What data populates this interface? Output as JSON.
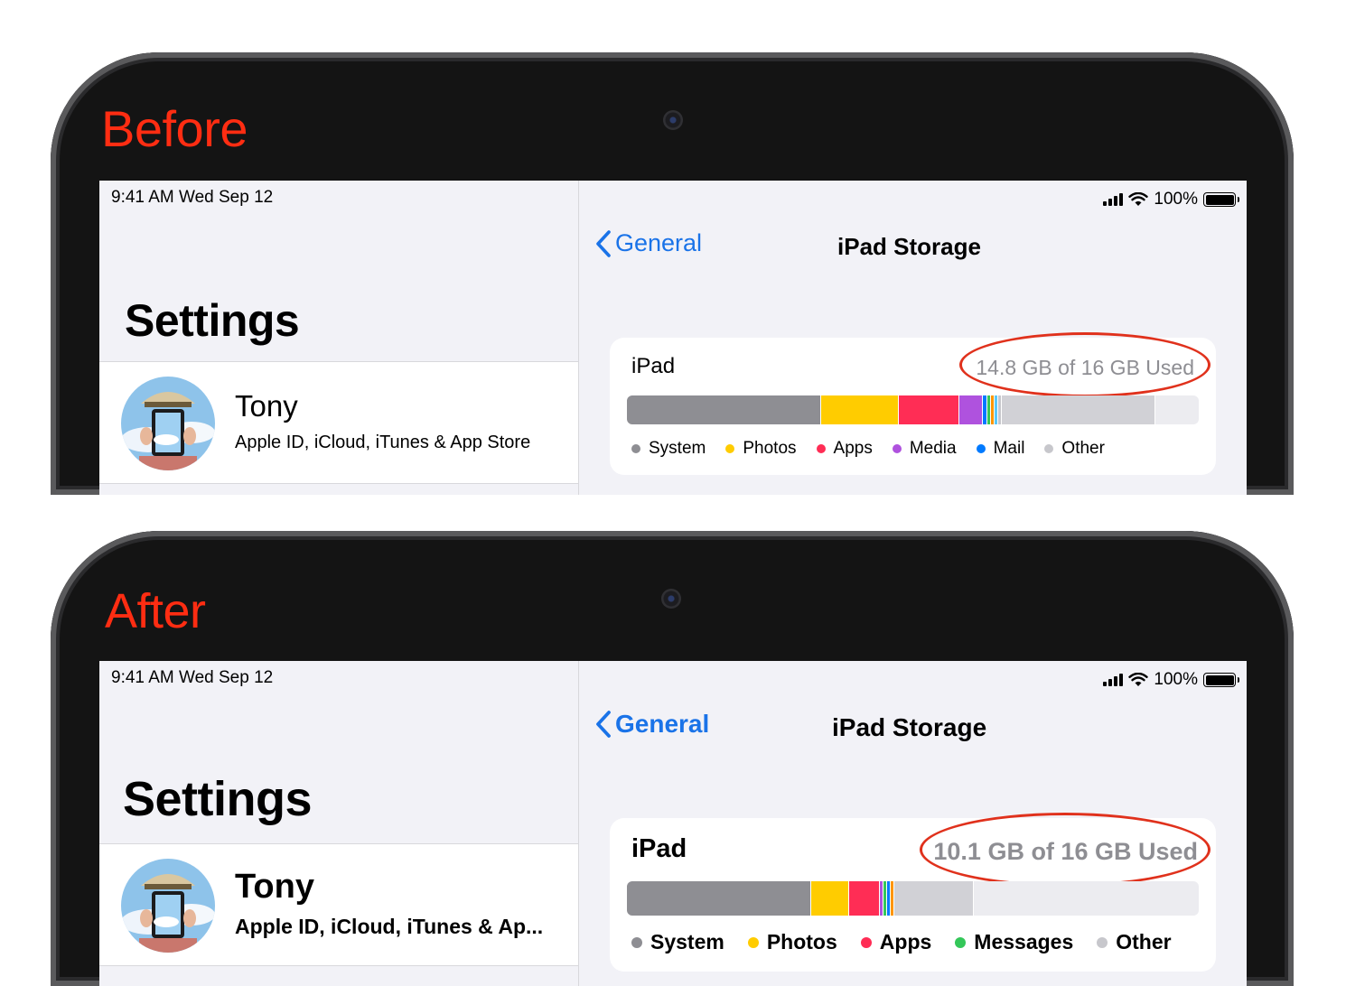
{
  "panels": [
    {
      "label": "Before",
      "status": {
        "time": "9:41 AM   Wed Sep 12",
        "battery": "100%"
      },
      "settings_title": "Settings",
      "profile": {
        "name": "Tony",
        "subtitle": "Apple ID, iCloud, iTunes & App Store"
      },
      "nav": {
        "back_label": "General",
        "title": "iPad Storage"
      },
      "storage": {
        "device": "iPad",
        "used_text": "14.8 GB of 16 GB Used",
        "used_fraction": 0.925,
        "segments": [
          {
            "name": "System",
            "share": 0.339,
            "color": "#8e8e93"
          },
          {
            "name": "Photos",
            "share": 0.137,
            "color": "#ffcc00"
          },
          {
            "name": "Apps",
            "share": 0.106,
            "color": "#ff2d55"
          },
          {
            "name": "Media",
            "share": 0.041,
            "color": "#af52de"
          },
          {
            "name": "Mail",
            "share": 0.008,
            "color": "#007aff"
          },
          {
            "name": "misc1",
            "share": 0.006,
            "color": "#34c759"
          },
          {
            "name": "misc2",
            "share": 0.006,
            "color": "#ff9500"
          },
          {
            "name": "misc3",
            "share": 0.006,
            "color": "#5ac8fa"
          },
          {
            "name": "misc4",
            "share": 0.006,
            "color": "#c7c7cc"
          },
          {
            "name": "Other",
            "share": 0.27,
            "color": "#d1d1d6"
          }
        ],
        "legend": [
          {
            "label": "System",
            "color": "#8e8e93"
          },
          {
            "label": "Photos",
            "color": "#ffcc00"
          },
          {
            "label": "Apps",
            "color": "#ff2d55"
          },
          {
            "name": "Media",
            "label": "Media",
            "color": "#af52de"
          },
          {
            "label": "Mail",
            "color": "#007aff"
          },
          {
            "label": "Other",
            "color": "#c7c7cc"
          }
        ]
      }
    },
    {
      "label": "After",
      "status": {
        "time": "9:41 AM   Wed Sep 12",
        "battery": "100%"
      },
      "settings_title": "Settings",
      "profile": {
        "name": "Tony",
        "subtitle": "Apple ID, iCloud, iTunes & Ap..."
      },
      "nav": {
        "back_label": "General",
        "title": "iPad Storage"
      },
      "storage": {
        "device": "iPad",
        "used_text": "10.1 GB of 16 GB Used",
        "used_fraction": 0.631,
        "segments": [
          {
            "name": "System",
            "share": 0.323,
            "color": "#8e8e93"
          },
          {
            "name": "Photos",
            "share": 0.065,
            "color": "#ffcc00"
          },
          {
            "name": "Apps",
            "share": 0.055,
            "color": "#ff2d55"
          },
          {
            "name": "misc1",
            "share": 0.006,
            "color": "#af52de"
          },
          {
            "name": "misc2",
            "share": 0.006,
            "color": "#34c759"
          },
          {
            "name": "misc3",
            "share": 0.006,
            "color": "#007aff"
          },
          {
            "name": "misc4",
            "share": 0.006,
            "color": "#ff9500"
          },
          {
            "name": "Other",
            "share": 0.14,
            "color": "#d1d1d6"
          }
        ],
        "legend": [
          {
            "label": "System",
            "color": "#8e8e93"
          },
          {
            "label": "Photos",
            "color": "#ffcc00"
          },
          {
            "label": "Apps",
            "color": "#ff2d55"
          },
          {
            "label": "Messages",
            "color": "#34c759"
          },
          {
            "label": "Other",
            "color": "#c7c7cc"
          }
        ]
      }
    }
  ]
}
